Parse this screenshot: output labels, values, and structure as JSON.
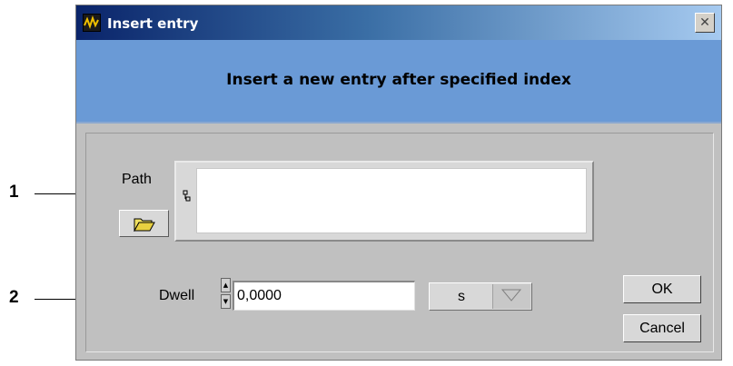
{
  "callouts": {
    "one": "1",
    "two": "2"
  },
  "window": {
    "title": "Insert entry",
    "close_glyph": "✕",
    "banner_text": "Insert a new entry after specified index",
    "colors": {
      "titlebar_start": "#0a246a",
      "titlebar_end": "#a6caf0",
      "banner": "#6a9ad6",
      "panel": "#c0c0c0"
    }
  },
  "form": {
    "path_label": "Path",
    "path_value": "",
    "path_icon": "path-glyph-icon",
    "browse_icon": "folder-open-icon",
    "dwell_label": "Dwell",
    "dwell_value": "0,0000",
    "unit_value": "s"
  },
  "buttons": {
    "ok": "OK",
    "cancel": "Cancel"
  }
}
